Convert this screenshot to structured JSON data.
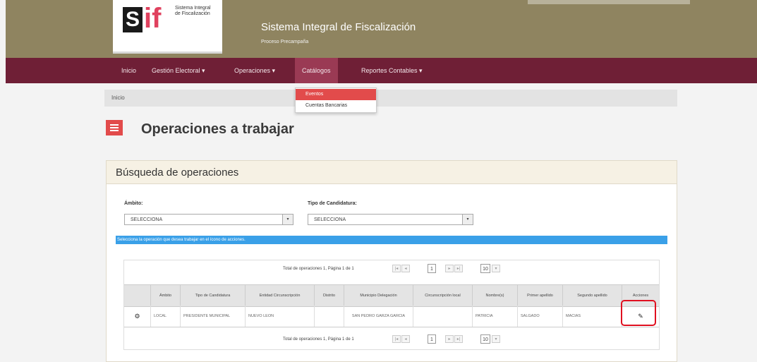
{
  "header": {
    "logo_letters_s": "S",
    "logo_letters_if": "if",
    "logo_text": "Sistema Integral de Fiscalización",
    "title": "Sistema Integral de Fiscalización",
    "subtitle": "Proceso Precampaña"
  },
  "nav": {
    "items": [
      "Inicio",
      "Gestión Electoral ▾",
      "Operaciones ▾",
      "Catálogos",
      "Reportes Contables ▾"
    ]
  },
  "dropdown": {
    "items": [
      "Eventos",
      "Cuentas Bancarias"
    ]
  },
  "breadcrumb": "Inicio",
  "page_title": "Operaciones a trabajar",
  "search": {
    "title": "Búsqueda de operaciones",
    "ambito_label": "Ámbito:",
    "ambito_value": "SELECCIONA",
    "tipo_label": "Tipo de Candidatura:",
    "tipo_value": "SELECCIONA",
    "info_bar": "Selecciona la operación que desea trabajar en el ícono de acciones."
  },
  "grid": {
    "pager_text": "Total de operaciones 1, Página 1 de 1",
    "page_input": "1",
    "page_size": "10",
    "columns": [
      "",
      "Ámbito",
      "Tipo de Candidatura",
      "Entidad Circunscripción",
      "Distrito",
      "Municipio Delegación",
      "Circunscripción local",
      "Nombre(s)",
      "Primer apellido",
      "Segundo apellido",
      "Acciones"
    ],
    "row": [
      "⚙",
      "LOCAL",
      "PRESIDENTE MUNICIPAL",
      "NUEVO LEON",
      "",
      "SAN PEDRO GARZA GARCIA",
      "",
      "PATRICIA",
      "SALGADO",
      "MACIAS",
      "✎"
    ]
  },
  "colors": {
    "header_bg": "#8f8460",
    "navbar_bg": "#6f1f36",
    "accent_red": "#e24b4b",
    "info_blue": "#3aa0e8",
    "highlight_red": "#e01020"
  }
}
